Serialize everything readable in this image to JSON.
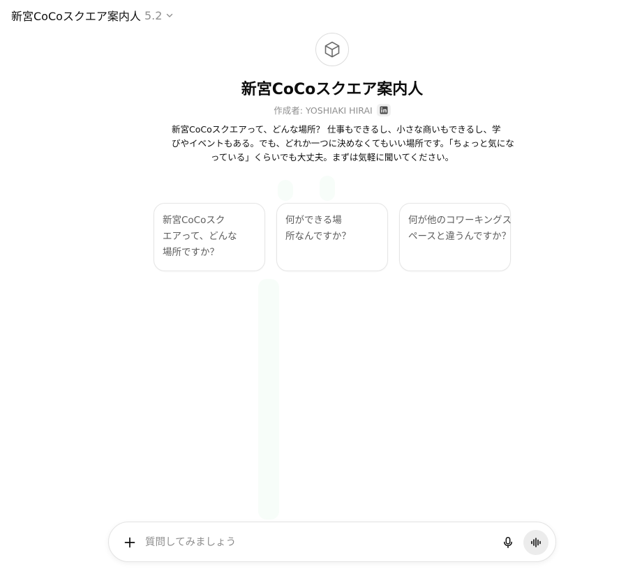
{
  "header": {
    "model_name": "新宮CoCoスクエア案内人",
    "model_version": "5.2"
  },
  "gpt": {
    "avatar_icon": "cube-icon",
    "title": "新宮CoCoスクエア案内人",
    "author": "作成者: YOSHIAKI HIRAI",
    "author_link_icon": "linkedin-icon",
    "description_lines": [
      "新宮CoCoスクエアって、どんな場所？ 仕事もできるし、小さな商いもできるし、学",
      "びやイベントもある。でも、どれか一つに決めなくてもいい場所です。「ちょっと気にな",
      "っている」くらいでも大丈夫。まずは気軽に聞いてください。"
    ]
  },
  "starters": [
    {
      "lines": [
        "新宮CoCoスク",
        "エアって、どんな",
        "場所ですか？"
      ]
    },
    {
      "lines": [
        "何ができる場",
        "所なんですか？"
      ]
    },
    {
      "lines": [
        "何が他のコワーキングス",
        "ペースと違うんですか？"
      ]
    }
  ],
  "composer": {
    "placeholder": "質問してみましょう",
    "value": "",
    "plus_icon": "plus-icon",
    "mic_icon": "microphone-icon",
    "voice_icon": "voice-mode-icon"
  }
}
